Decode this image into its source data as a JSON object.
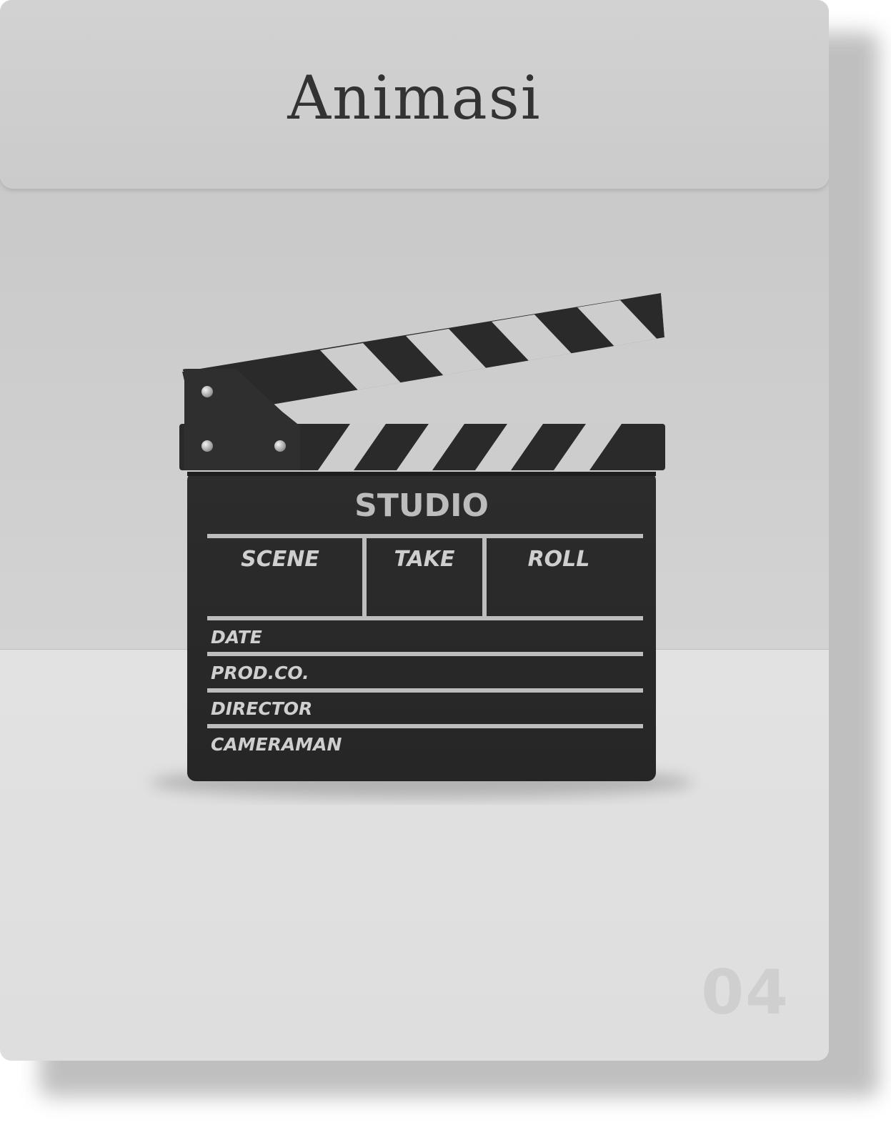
{
  "card": {
    "title": "Animasi",
    "page_number": "04"
  },
  "clapperboard": {
    "heading": "STUDIO",
    "columns": [
      "SCENE",
      "TAKE",
      "ROLL"
    ],
    "rows": [
      "DATE",
      "PROD.CO.",
      "DIRECTOR",
      "CAMERAMAN"
    ]
  }
}
